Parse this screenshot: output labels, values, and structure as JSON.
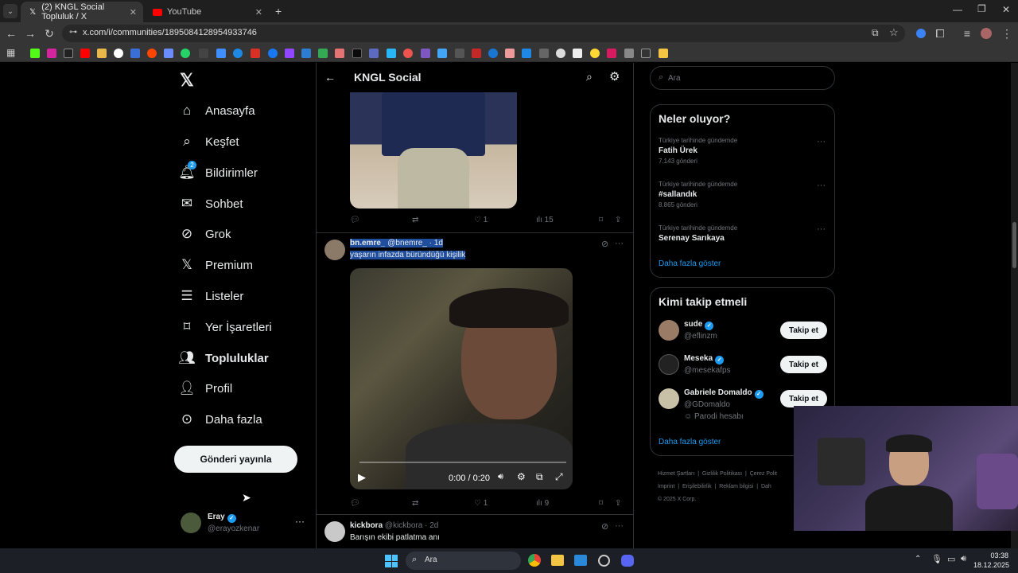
{
  "browser": {
    "tabs": [
      {
        "title": "(2) KNGL Social Topluluk / X",
        "active": true
      },
      {
        "title": "YouTube",
        "active": false
      }
    ],
    "url": "x.com/i/communities/1895084128954933746"
  },
  "sidebar": {
    "items": [
      {
        "label": "Anasayfa",
        "icon": "home-icon"
      },
      {
        "label": "Keşfet",
        "icon": "search-icon"
      },
      {
        "label": "Bildirimler",
        "icon": "bell-icon",
        "badge": "2"
      },
      {
        "label": "Sohbet",
        "icon": "mail-icon"
      },
      {
        "label": "Grok",
        "icon": "grok-icon"
      },
      {
        "label": "Premium",
        "icon": "x-logo-icon"
      },
      {
        "label": "Listeler",
        "icon": "list-icon"
      },
      {
        "label": "Yer İşaretleri",
        "icon": "bookmark-icon"
      },
      {
        "label": "Topluluklar",
        "icon": "people-icon"
      },
      {
        "label": "Profil",
        "icon": "person-icon"
      },
      {
        "label": "Daha fazla",
        "icon": "more-circle-icon"
      }
    ],
    "post_button": "Gönderi yayınla",
    "account": {
      "name": "Eray",
      "handle": "@erayozkenar"
    }
  },
  "header": {
    "title": "KNGL Social"
  },
  "posts": [
    {
      "stats": {
        "replies": "",
        "reposts": "",
        "likes": "1",
        "views": "15"
      }
    },
    {
      "name": "bn.emre_",
      "handle": "@bnemre_",
      "time": "· 1d",
      "text": "yaşarın infazda büründüğü kişilik",
      "video_time": "0:00 / 0:20",
      "stats": {
        "replies": "",
        "reposts": "",
        "likes": "1",
        "views": "9"
      }
    },
    {
      "name": "kickbora",
      "handle": "@kickbora",
      "time": "· 2d",
      "text": "Barışın ekibi patlatma anı"
    }
  ],
  "right": {
    "search_placeholder": "Ara",
    "trends_title": "Neler oluyor?",
    "trends": [
      {
        "context": "Türkiye tarihinde gündemde",
        "name": "Fatih Ürek",
        "count": "7.143 gönderi"
      },
      {
        "context": "Türkiye tarihinde gündemde",
        "name": "#sallandık",
        "count": "8.865 gönderi"
      },
      {
        "context": "Türkiye tarihinde gündemde",
        "name": "Serenay Sarıkaya",
        "count": ""
      }
    ],
    "show_more": "Daha fazla göster",
    "who_title": "Kimi takip etmeli",
    "who": [
      {
        "name": "sude",
        "handle": "@eflinzm",
        "note": ""
      },
      {
        "name": "Meseka",
        "handle": "@mesekafps",
        "note": ""
      },
      {
        "name": "Gabriele Domaldo",
        "handle": "@GDomaldo",
        "note": "Parodi hesabı"
      }
    ],
    "follow_label": "Takip et",
    "show_more2": "Daha fazla göster",
    "footer": [
      "Hizmet Şartları",
      "|",
      "Gizlilik Politikası",
      "|",
      "Çerez Polit",
      "İmprint",
      "|",
      "Erişilebilirlik",
      "|",
      "Reklam bilgisi",
      "|",
      "Dah",
      "© 2025 X Corp."
    ]
  },
  "taskbar": {
    "search": "Ara",
    "time": "03:38",
    "date": "18.12.2025"
  },
  "colors": {
    "accent": "#1d9bf0",
    "selection": "#1f4e9e"
  }
}
